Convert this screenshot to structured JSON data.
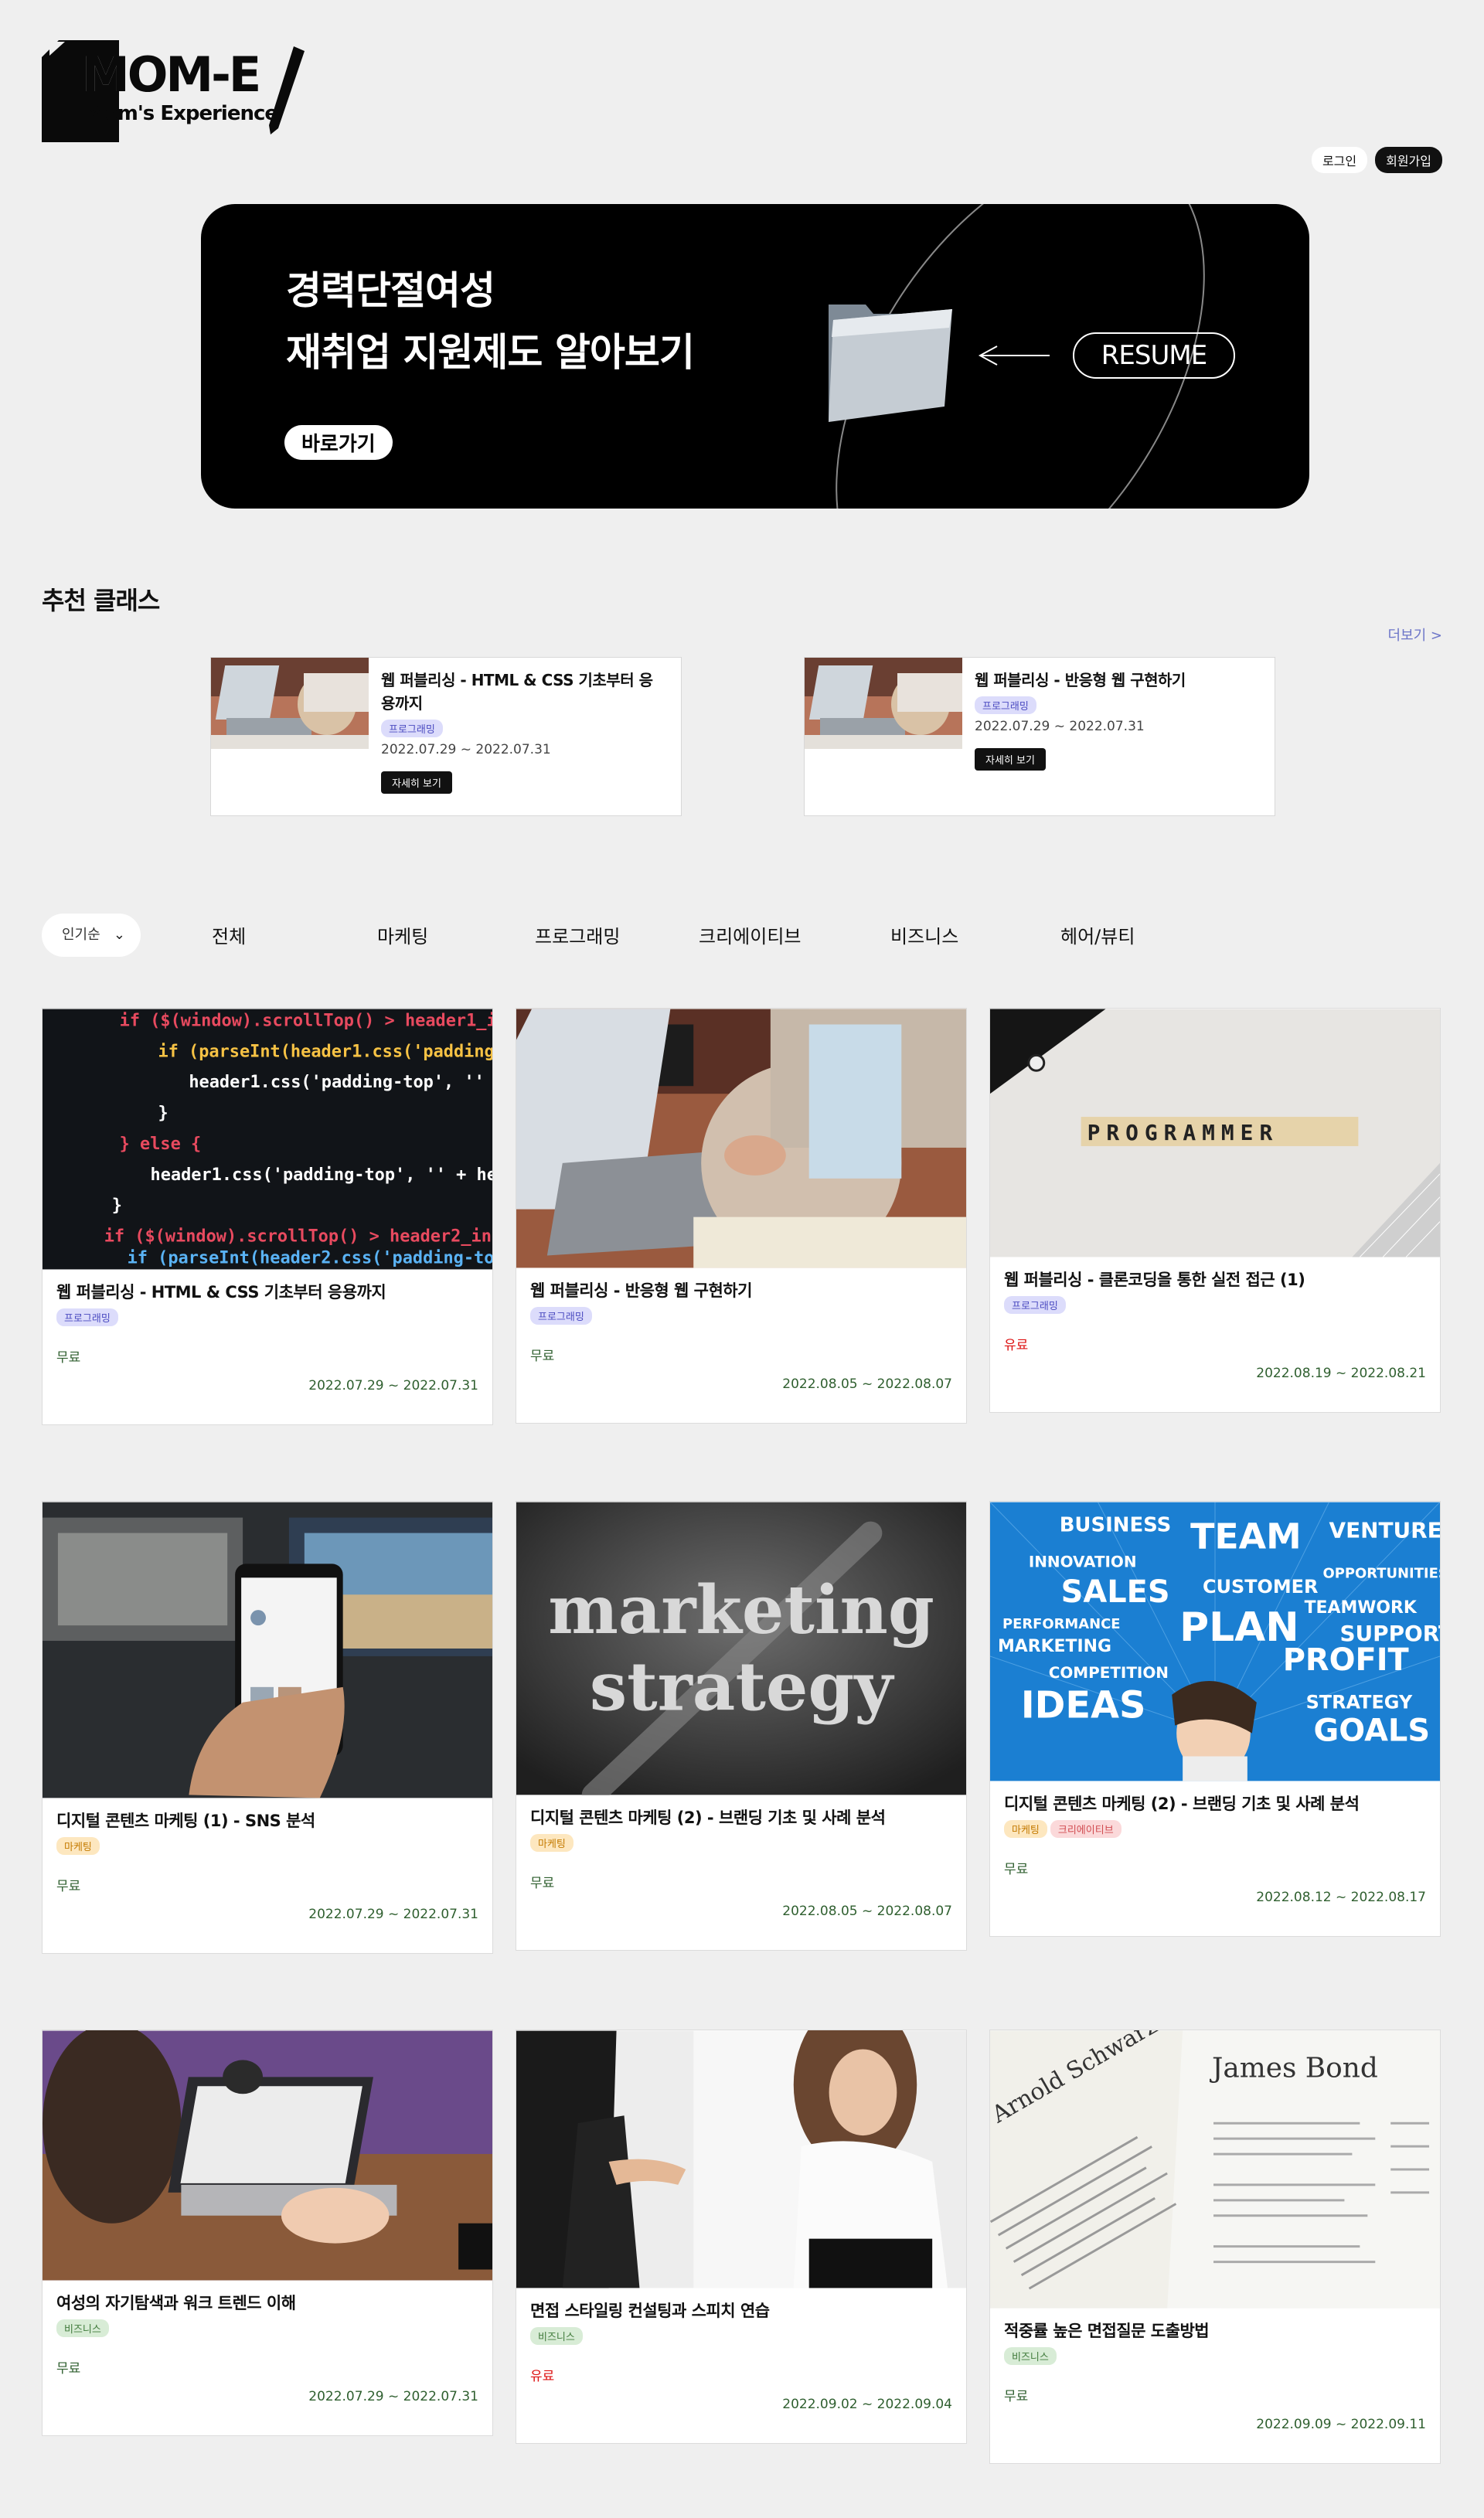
{
  "header": {
    "logo_main": "MOM-E",
    "logo_sub": "Mom's Experience",
    "login": "로그인",
    "signup": "회원가입"
  },
  "banner": {
    "line1": "경력단절여성",
    "line2": "재취업 지원제도 알아보기",
    "cta": "바로가기",
    "resume": "RESUME"
  },
  "recommended": {
    "title": "추천 클래스",
    "more": "더보기 >",
    "items": [
      {
        "title": "웹 퍼블리싱 - HTML & CSS 기초부터 응용까지",
        "tag": "프로그래밍",
        "date": "2022.07.29 ~ 2022.07.31",
        "button": "자세히 보기"
      },
      {
        "title": "웹 퍼블리싱 - 반응형 웹 구현하기",
        "tag": "프로그래밍",
        "date": "2022.07.29 ~ 2022.07.31",
        "button": "자세히 보기"
      }
    ]
  },
  "filter": {
    "sort": "인기순",
    "tabs": [
      "전체",
      "마케팅",
      "프로그래밍",
      "크리에이티브",
      "비즈니스",
      "헤어/뷰티"
    ]
  },
  "courses": [
    {
      "title": "웹 퍼블리싱 - HTML & CSS 기초부터 응용까지",
      "tags": [
        "프로그래밍"
      ],
      "price": "무료",
      "date": "2022.07.29 ~ 2022.07.31",
      "image": "code-screen"
    },
    {
      "title": "웹 퍼블리싱 - 반응형 웹 구현하기",
      "tags": [
        "프로그래밍"
      ],
      "price": "무료",
      "date": "2022.08.05 ~ 2022.08.07",
      "image": "laptop-desk"
    },
    {
      "title": "웹 퍼블리싱 - 클론코딩을 통한 실전 접근 (1)",
      "tags": [
        "프로그래밍"
      ],
      "price": "유료",
      "date": "2022.08.19 ~ 2022.08.21",
      "image": "programmer-tiles",
      "tile_text": "PROGRAMMER"
    },
    {
      "title": "디지털 콘텐츠 마케팅 (1) - SNS 분석",
      "tags": [
        "마케팅"
      ],
      "price": "무료",
      "date": "2022.07.29 ~ 2022.07.31",
      "image": "phone-hand"
    },
    {
      "title": "디지털 콘텐츠 마케팅 (2) - 브랜딩 기초 및 사례 분석",
      "tags": [
        "마케팅"
      ],
      "price": "무료",
      "date": "2022.08.05 ~ 2022.08.07",
      "image": "chalkboard",
      "board_text1": "marketing",
      "board_text2": "strategy"
    },
    {
      "title": "디지털 콘텐츠 마케팅 (2) - 브랜딩 기초 및 사례 분석",
      "tags": [
        "마케팅",
        "크리에이티브"
      ],
      "price": "무료",
      "date": "2022.08.12 ~ 2022.08.17",
      "image": "business-words",
      "words": [
        "BUSINESS",
        "TEAM",
        "VENTURE",
        "INNOVATION",
        "SALES",
        "CUSTOMER",
        "OPPORTUNITIES",
        "PERFORMANCE",
        "PLAN",
        "TEAMWORK",
        "SUPPORT",
        "MARKETING",
        "PROFIT",
        "COMPETITION",
        "IDEAS",
        "STRATEGY",
        "GOALS"
      ]
    },
    {
      "title": "여성의 자기탐색과 워크 트렌드 이해",
      "tags": [
        "비즈니스"
      ],
      "price": "무료",
      "date": "2022.07.29 ~ 2022.07.31",
      "image": "woman-laptop"
    },
    {
      "title": "면접 스타일링 컨설팅과 스피치 연습",
      "tags": [
        "비즈니스"
      ],
      "price": "유료",
      "date": "2022.09.02 ~ 2022.09.04",
      "image": "handshake"
    },
    {
      "title": "적중률 높은 면접질문 도출방법",
      "tags": [
        "비즈니스"
      ],
      "price": "무료",
      "date": "2022.09.09 ~ 2022.09.11",
      "image": "resume-papers",
      "paper_name1": "Arnold Schwarznegger",
      "paper_name2": "James Bond"
    }
  ]
}
